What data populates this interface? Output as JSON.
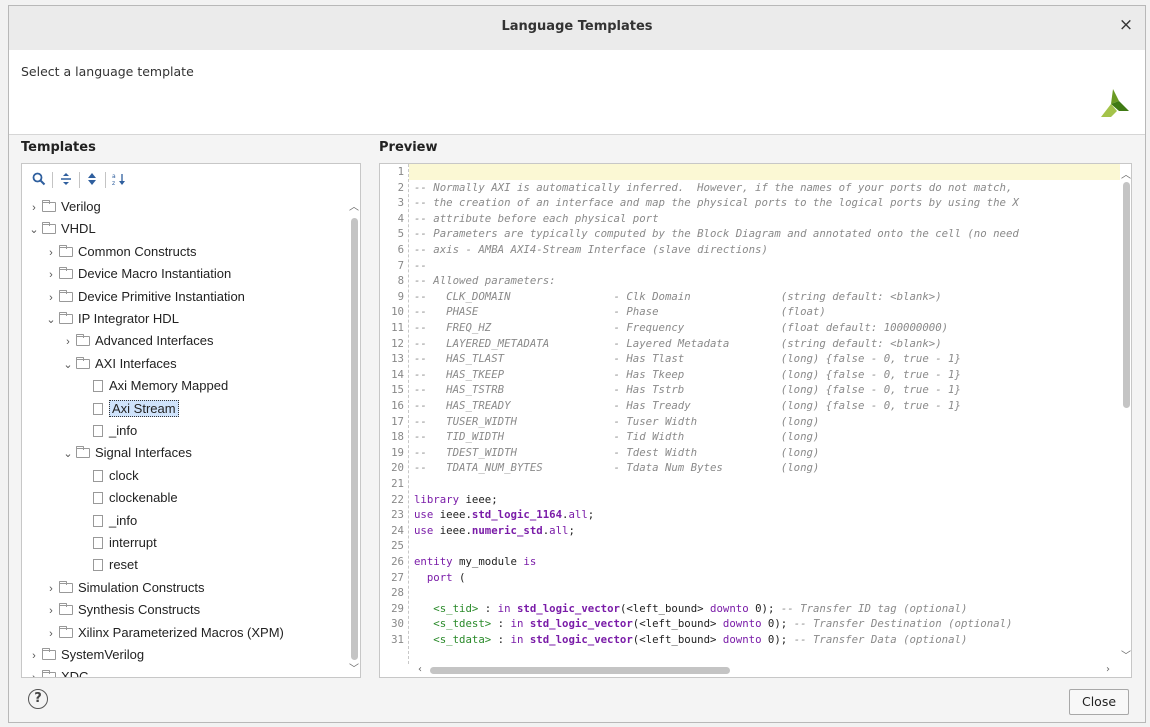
{
  "window": {
    "title": "Language Templates",
    "close_glyph": "×"
  },
  "header": {
    "subtitle": "Select a language template",
    "logo_icon": "xilinx-logo-icon"
  },
  "templates": {
    "label": "Templates",
    "toolbar": {
      "search_icon": "search-icon",
      "collapse_all_icon": "collapse-all-icon",
      "expand_all_icon": "expand-all-icon",
      "sort_icon": "sort-icon"
    }
  },
  "tree": [
    {
      "label": "Verilog",
      "depth": 0,
      "kind": "folder",
      "expanded": false
    },
    {
      "label": "VHDL",
      "depth": 0,
      "kind": "folder",
      "expanded": true
    },
    {
      "label": "Common Constructs",
      "depth": 1,
      "kind": "folder",
      "expanded": false
    },
    {
      "label": "Device Macro Instantiation",
      "depth": 1,
      "kind": "folder",
      "expanded": false
    },
    {
      "label": "Device Primitive Instantiation",
      "depth": 1,
      "kind": "folder",
      "expanded": false
    },
    {
      "label": "IP Integrator HDL",
      "depth": 1,
      "kind": "folder",
      "expanded": true
    },
    {
      "label": "Advanced Interfaces",
      "depth": 2,
      "kind": "folder",
      "expanded": false
    },
    {
      "label": "AXI Interfaces",
      "depth": 2,
      "kind": "folder",
      "expanded": true
    },
    {
      "label": "Axi Memory Mapped",
      "depth": 3,
      "kind": "file"
    },
    {
      "label": "Axi Stream",
      "depth": 3,
      "kind": "file",
      "selected": true
    },
    {
      "label": "_info",
      "depth": 3,
      "kind": "file"
    },
    {
      "label": "Signal Interfaces",
      "depth": 2,
      "kind": "folder",
      "expanded": true
    },
    {
      "label": "clock",
      "depth": 3,
      "kind": "file"
    },
    {
      "label": "clockenable",
      "depth": 3,
      "kind": "file"
    },
    {
      "label": "_info",
      "depth": 3,
      "kind": "file"
    },
    {
      "label": "interrupt",
      "depth": 3,
      "kind": "file"
    },
    {
      "label": "reset",
      "depth": 3,
      "kind": "file"
    },
    {
      "label": "Simulation Constructs",
      "depth": 1,
      "kind": "folder",
      "expanded": false
    },
    {
      "label": "Synthesis Constructs",
      "depth": 1,
      "kind": "folder",
      "expanded": false
    },
    {
      "label": "Xilinx Parameterized Macros (XPM)",
      "depth": 1,
      "kind": "folder",
      "expanded": false
    },
    {
      "label": "SystemVerilog",
      "depth": 0,
      "kind": "folder",
      "expanded": false
    },
    {
      "label": "XDC",
      "depth": 0,
      "kind": "folder",
      "expanded": false
    }
  ],
  "preview": {
    "label": "Preview",
    "lines": [
      {
        "n": "1",
        "segs": []
      },
      {
        "n": "2",
        "segs": [
          {
            "c": "cmt",
            "t": "-- Normally AXI is automatically inferred.  However, if the names of your ports do not match, "
          }
        ]
      },
      {
        "n": "3",
        "segs": [
          {
            "c": "cmt",
            "t": "-- the creation of an interface and map the physical ports to the logical ports by using the X"
          }
        ]
      },
      {
        "n": "4",
        "segs": [
          {
            "c": "cmt",
            "t": "-- attribute before each physical port"
          }
        ]
      },
      {
        "n": "5",
        "segs": [
          {
            "c": "cmt",
            "t": "-- Parameters are typically computed by the Block Diagram and annotated onto the cell (no need"
          }
        ]
      },
      {
        "n": "6",
        "segs": [
          {
            "c": "cmt",
            "t": "-- axis - AMBA AXI4-Stream Interface (slave directions)"
          }
        ]
      },
      {
        "n": "7",
        "segs": [
          {
            "c": "cmt",
            "t": "--"
          }
        ]
      },
      {
        "n": "8",
        "segs": [
          {
            "c": "cmt",
            "t": "-- Allowed parameters:"
          }
        ]
      },
      {
        "n": "9",
        "segs": [
          {
            "c": "cmt",
            "t": "--   CLK_DOMAIN                - Clk Domain              (string default: <blank>)"
          }
        ]
      },
      {
        "n": "10",
        "segs": [
          {
            "c": "cmt",
            "t": "--   PHASE                     - Phase                   (float)"
          }
        ]
      },
      {
        "n": "11",
        "segs": [
          {
            "c": "cmt",
            "t": "--   FREQ_HZ                   - Frequency               (float default: 100000000)"
          }
        ]
      },
      {
        "n": "12",
        "segs": [
          {
            "c": "cmt",
            "t": "--   LAYERED_METADATA          - Layered Metadata        (string default: <blank>)"
          }
        ]
      },
      {
        "n": "13",
        "segs": [
          {
            "c": "cmt",
            "t": "--   HAS_TLAST                 - Has Tlast               (long) {false - 0, true - 1}"
          }
        ]
      },
      {
        "n": "14",
        "segs": [
          {
            "c": "cmt",
            "t": "--   HAS_TKEEP                 - Has Tkeep               (long) {false - 0, true - 1}"
          }
        ]
      },
      {
        "n": "15",
        "segs": [
          {
            "c": "cmt",
            "t": "--   HAS_TSTRB                 - Has Tstrb               (long) {false - 0, true - 1}"
          }
        ]
      },
      {
        "n": "16",
        "segs": [
          {
            "c": "cmt",
            "t": "--   HAS_TREADY                - Has Tready              (long) {false - 0, true - 1}"
          }
        ]
      },
      {
        "n": "17",
        "segs": [
          {
            "c": "cmt",
            "t": "--   TUSER_WIDTH               - Tuser Width             (long)"
          }
        ]
      },
      {
        "n": "18",
        "segs": [
          {
            "c": "cmt",
            "t": "--   TID_WIDTH                 - Tid Width               (long)"
          }
        ]
      },
      {
        "n": "19",
        "segs": [
          {
            "c": "cmt",
            "t": "--   TDEST_WIDTH               - Tdest Width             (long)"
          }
        ]
      },
      {
        "n": "20",
        "segs": [
          {
            "c": "cmt",
            "t": "--   TDATA_NUM_BYTES           - Tdata Num Bytes         (long)"
          }
        ]
      },
      {
        "n": "21",
        "segs": []
      },
      {
        "n": "22",
        "segs": [
          {
            "c": "kw",
            "t": "library"
          },
          {
            "c": "plain",
            "t": " ieee;"
          }
        ]
      },
      {
        "n": "23",
        "segs": [
          {
            "c": "kw",
            "t": "use"
          },
          {
            "c": "plain",
            "t": " ieee."
          },
          {
            "c": "typ",
            "t": "std_logic_1164"
          },
          {
            "c": "plain",
            "t": "."
          },
          {
            "c": "kw",
            "t": "all"
          },
          {
            "c": "plain",
            "t": ";"
          }
        ]
      },
      {
        "n": "24",
        "segs": [
          {
            "c": "kw",
            "t": "use"
          },
          {
            "c": "plain",
            "t": " ieee."
          },
          {
            "c": "typ",
            "t": "numeric_std"
          },
          {
            "c": "plain",
            "t": "."
          },
          {
            "c": "kw",
            "t": "all"
          },
          {
            "c": "plain",
            "t": ";"
          }
        ]
      },
      {
        "n": "25",
        "segs": []
      },
      {
        "n": "26",
        "segs": [
          {
            "c": "kw",
            "t": "entity"
          },
          {
            "c": "plain",
            "t": " my_module "
          },
          {
            "c": "kw",
            "t": "is"
          }
        ]
      },
      {
        "n": "27",
        "segs": [
          {
            "c": "kw",
            "t": "  port"
          },
          {
            "c": "plain",
            "t": " ("
          }
        ]
      },
      {
        "n": "28",
        "segs": []
      },
      {
        "n": "29",
        "segs": [
          {
            "c": "grn",
            "t": "   <s_tid>"
          },
          {
            "c": "plain",
            "t": " : "
          },
          {
            "c": "kw",
            "t": "in"
          },
          {
            "c": "plain",
            "t": " "
          },
          {
            "c": "typ",
            "t": "std_logic_vector"
          },
          {
            "c": "plain",
            "t": "(<left_bound> "
          },
          {
            "c": "kw",
            "t": "downto"
          },
          {
            "c": "plain",
            "t": " 0); "
          },
          {
            "c": "cmt",
            "t": "-- Transfer ID tag (optional)"
          }
        ]
      },
      {
        "n": "30",
        "segs": [
          {
            "c": "grn",
            "t": "   <s_tdest>"
          },
          {
            "c": "plain",
            "t": " : "
          },
          {
            "c": "kw",
            "t": "in"
          },
          {
            "c": "plain",
            "t": " "
          },
          {
            "c": "typ",
            "t": "std_logic_vector"
          },
          {
            "c": "plain",
            "t": "(<left_bound> "
          },
          {
            "c": "kw",
            "t": "downto"
          },
          {
            "c": "plain",
            "t": " 0); "
          },
          {
            "c": "cmt",
            "t": "-- Transfer Destination (optional)"
          }
        ]
      },
      {
        "n": "31",
        "segs": [
          {
            "c": "grn",
            "t": "   <s_tdata>"
          },
          {
            "c": "plain",
            "t": " : "
          },
          {
            "c": "kw",
            "t": "in"
          },
          {
            "c": "plain",
            "t": " "
          },
          {
            "c": "typ",
            "t": "std_logic_vector"
          },
          {
            "c": "plain",
            "t": "(<left_bound> "
          },
          {
            "c": "kw",
            "t": "downto"
          },
          {
            "c": "plain",
            "t": " 0); "
          },
          {
            "c": "cmt",
            "t": "-- Transfer Data (optional)"
          }
        ]
      }
    ]
  },
  "footer": {
    "help_glyph": "?",
    "close_label": "Close"
  }
}
